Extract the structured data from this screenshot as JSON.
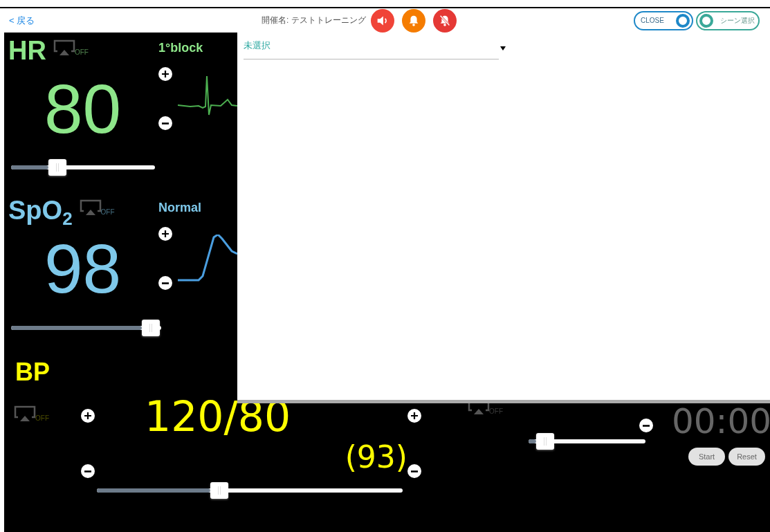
{
  "header": {
    "back_link": "< 戻る",
    "event_label": "開催名: テストトレーニング",
    "sound_buttons": [
      {
        "kind": "speaker",
        "color": "#f04438"
      },
      {
        "kind": "bell",
        "color": "#f57c00"
      },
      {
        "kind": "bell-off",
        "color": "#e53935"
      }
    ],
    "toggles": [
      {
        "label": "CLOSE",
        "on": true,
        "color": "#1e88c8"
      },
      {
        "label": "シーン選択",
        "on": false,
        "color": "#3aa898"
      }
    ]
  },
  "vitals": [
    {
      "kind": "hr",
      "label": "HR",
      "off_label": "OFF",
      "status": "1°block",
      "value": "80",
      "level": 0.32,
      "color": "#8ee68a"
    },
    {
      "kind": "spo2",
      "label": "SpO$_{2}$",
      "off_label": "OFF",
      "status": "Normal",
      "value": "98",
      "level": 0.93,
      "color": "#7ec8ea"
    }
  ],
  "bp": {
    "label": "BP",
    "off_label": "OFF",
    "value": "120/80",
    "mean": "(93)",
    "level": 0.4
  },
  "rr": {
    "off_label": "OFF",
    "level": 0.14
  },
  "timer": {
    "time": "00:00",
    "buttons": [
      "Start",
      "Reset"
    ]
  },
  "scene_panel": {
    "dropdown": {
      "value": "未選択"
    }
  }
}
